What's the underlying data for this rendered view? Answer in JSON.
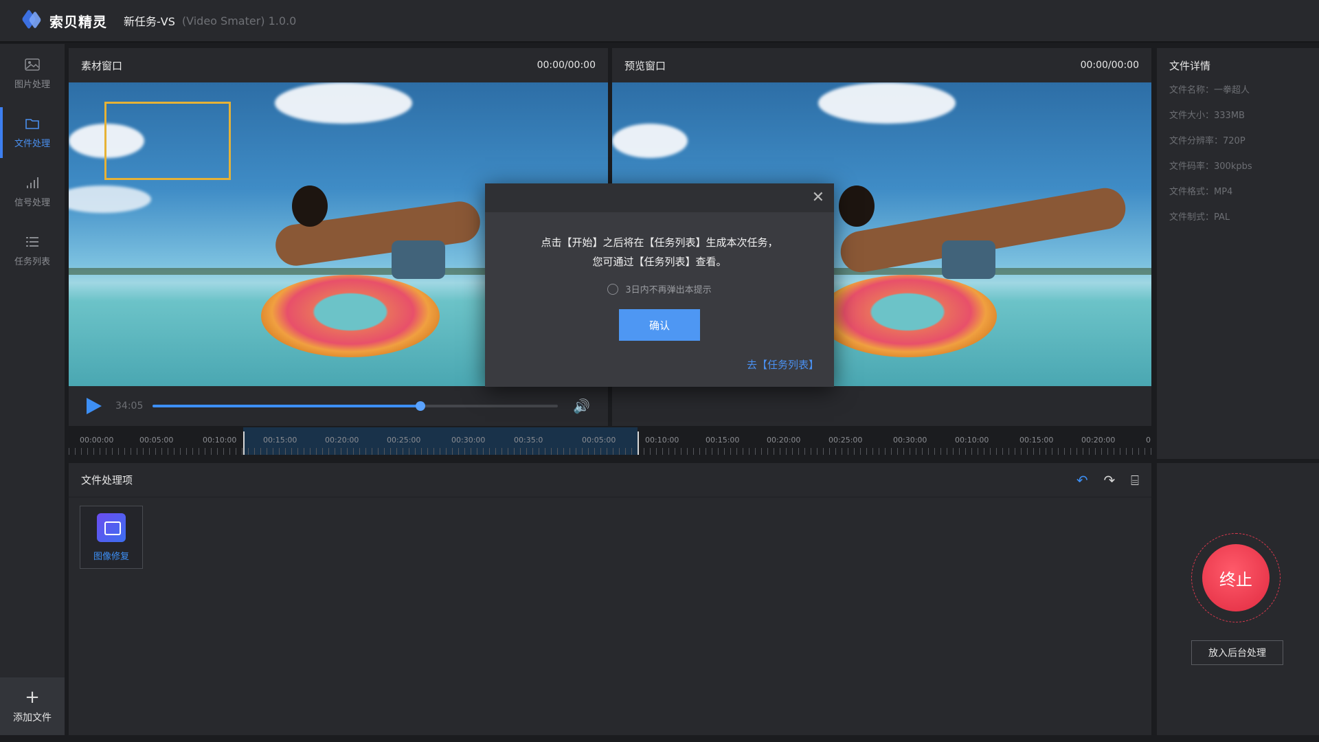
{
  "app": {
    "logo_text": "索贝精灵",
    "title": "新任务-VS",
    "subtitle": "(Video Smater) 1.0.0"
  },
  "sidebar": {
    "items": [
      {
        "label": "图片处理",
        "icon": "image-icon",
        "active": false
      },
      {
        "label": "文件处理",
        "icon": "folder-icon",
        "active": true
      },
      {
        "label": "信号处理",
        "icon": "signal-icon",
        "active": false
      },
      {
        "label": "任务列表",
        "icon": "list-icon",
        "active": false
      }
    ],
    "add_label": "添加文件"
  },
  "source_panel": {
    "title": "素材窗口",
    "time": "00:00/00:00"
  },
  "preview_panel": {
    "title": "预览窗口",
    "time": "00:00/00:00"
  },
  "player": {
    "current": "34:05",
    "progress": 0.66
  },
  "timeline": {
    "labels": [
      "00:00:00",
      "00:05:00",
      "00:10:00",
      "00:15:00",
      "00:20:00",
      "00:25:00",
      "00:30:00",
      "00:35:0",
      "00:05:00",
      "00:10:00",
      "00:15:00",
      "00:20:00",
      "00:25:00",
      "00:30:00",
      "00:10:00",
      "00:15:00",
      "00:20:00",
      "0"
    ]
  },
  "details": {
    "title": "文件详情",
    "rows": [
      "文件名称：一拳超人",
      "文件大小：333MB",
      "文件分辨率：720P",
      "文件码率：300kpbs",
      "文件格式：MP4",
      "文件制式：PAL"
    ]
  },
  "processing": {
    "title": "文件处理项",
    "tools": [
      "undo-icon",
      "redo-icon",
      "clear-icon"
    ],
    "items": [
      {
        "label": "图像修复",
        "icon": "image-repair-icon"
      }
    ]
  },
  "modal": {
    "line1": "点击【开始】之后将在【任务列表】生成本次任务，",
    "line2": "您可通过【任务列表】查看。",
    "checkbox": "3日内不再弹出本提示",
    "confirm": "确认",
    "goto": "去【任务列表】"
  },
  "actions": {
    "stop": "终止",
    "background": "放入后台处理"
  },
  "colors": {
    "accent": "#3d8ff5",
    "stop": "#e02a40",
    "selection": "#e6b236"
  }
}
